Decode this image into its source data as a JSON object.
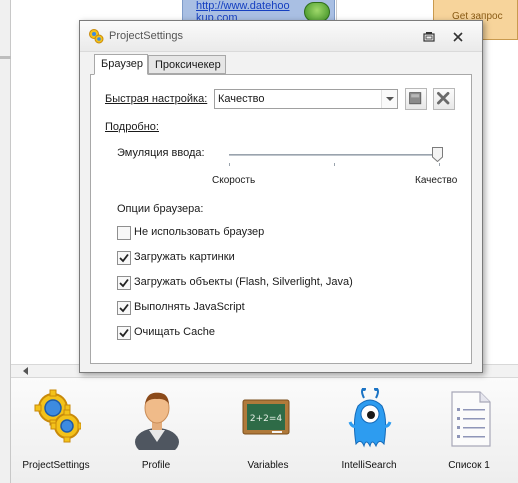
{
  "background": {
    "link_line1": "http://www.datehoo",
    "link_line2": "kup.com",
    "orange_button": "Get запрос"
  },
  "dialog": {
    "title": "ProjectSettings",
    "tabs": [
      {
        "label": "Браузер",
        "active": true
      },
      {
        "label": "Проксичекер",
        "active": false
      }
    ],
    "quick_setup_label": "Быстрая настройка:",
    "quick_setup_value": "Качество",
    "details_label": "Подробно:",
    "input_emulation_label": "Эмуляция ввода:",
    "input_emulation_level": 1.0,
    "slider_min_label": "Скорость",
    "slider_max_label": "Качество",
    "browser_options_label": "Опции браузера:",
    "options": [
      {
        "label": "Не использовать браузер",
        "checked": false
      },
      {
        "label": "Загружать картинки",
        "checked": true
      },
      {
        "label": "Загружать объекты (Flash, Silverlight, Java)",
        "checked": true
      },
      {
        "label": "Выполнять JavaScript",
        "checked": true
      },
      {
        "label": "Очищать Cache",
        "checked": true
      }
    ]
  },
  "toolbar": {
    "items": [
      {
        "label": "ProjectSettings",
        "icon": "gears-icon"
      },
      {
        "label": "Profile",
        "icon": "user-icon"
      },
      {
        "label": "Variables",
        "icon": "chalkboard-icon"
      },
      {
        "label": "IntelliSearch",
        "icon": "blue-monster-icon"
      },
      {
        "label": "Список 1",
        "icon": "list-document-icon"
      }
    ]
  },
  "colors": {
    "dialog_bg": "#f2f2f2",
    "panel_bg": "#ffffff",
    "link": "#1640c0",
    "orange_bg": "#f7d49b",
    "blue_cell": "#a9bfe3"
  }
}
